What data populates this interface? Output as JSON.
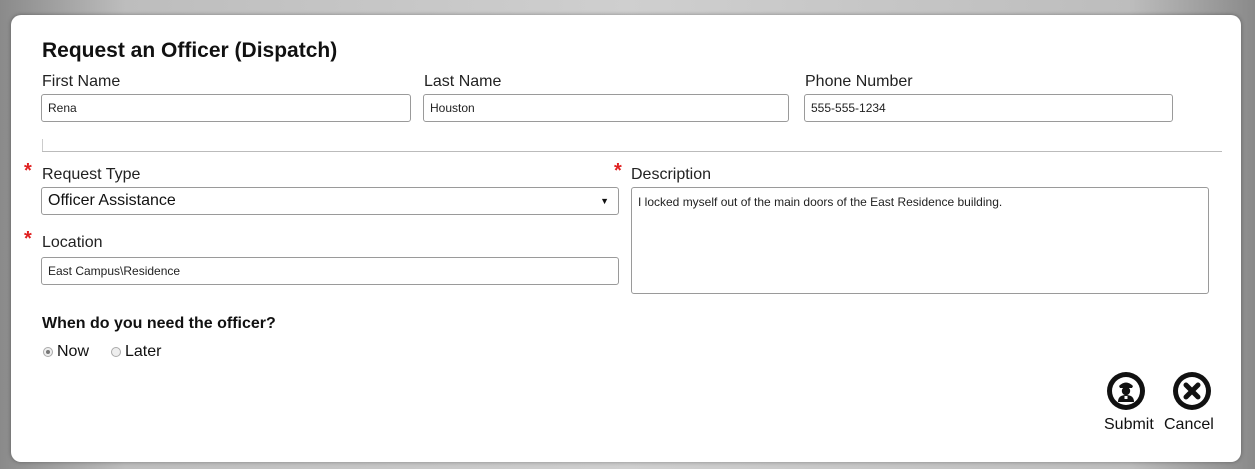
{
  "form": {
    "title": "Request an Officer (Dispatch)",
    "first_name": {
      "label": "First Name",
      "value": "Rena"
    },
    "last_name": {
      "label": "Last Name",
      "value": "Houston"
    },
    "phone": {
      "label": "Phone Number",
      "value": "555-555-1234"
    },
    "required_marker": "*",
    "request_type": {
      "label": "Request Type",
      "selected": "Officer Assistance",
      "arrow": "▼"
    },
    "location": {
      "label": "Location",
      "value": "East Campus\\Residence"
    },
    "description": {
      "label": "Description",
      "value": "I locked myself out of the main doors of the East Residence building."
    },
    "when": {
      "question": "When do you need the officer?",
      "options": [
        {
          "label": "Now",
          "checked": true
        },
        {
          "label": "Later",
          "checked": false
        }
      ]
    },
    "actions": {
      "submit_label": "Submit",
      "submit_icon": "officer-icon",
      "cancel_label": "Cancel",
      "cancel_icon": "close-icon"
    }
  },
  "colors": {
    "required": "#e02020",
    "background": "#cfcfcf",
    "panel": "#ffffff",
    "icon": "#111111"
  }
}
